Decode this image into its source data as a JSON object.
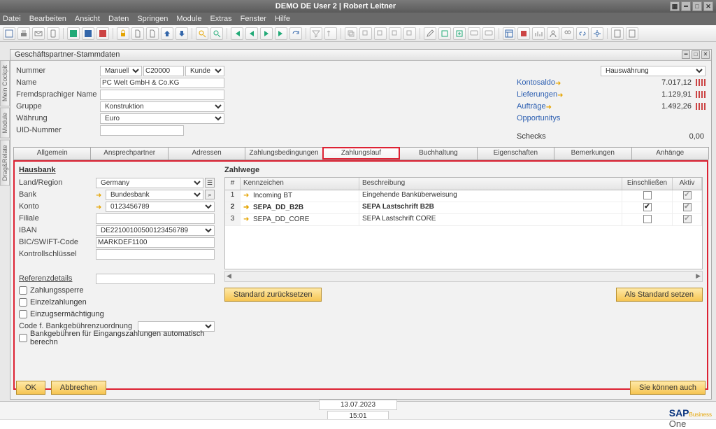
{
  "title_center": "DEMO DE User 2 | Robert Leitner",
  "menu": [
    "Datei",
    "Bearbeiten",
    "Ansicht",
    "Daten",
    "Springen",
    "Module",
    "Extras",
    "Fenster",
    "Hilfe"
  ],
  "window_title": "Geschäftspartner-Stammdaten",
  "sidetabs": [
    "Mein Cockpit",
    "Module",
    "Drag&Relate"
  ],
  "header": {
    "nummer_lbl": "Nummer",
    "nummer_mode": "Manuell",
    "nummer_val": "C20000",
    "nummer_type": "Kunde",
    "name_lbl": "Name",
    "name_val": "PC Welt GmbH & Co.KG",
    "fremd_lbl": "Fremdsprachiger Name",
    "fremd_val": "",
    "gruppe_lbl": "Gruppe",
    "gruppe_val": "Konstruktion",
    "waehrung_lbl": "Währung",
    "waehrung_val": "Euro",
    "uid_lbl": "UID-Nummer",
    "uid_val": ""
  },
  "right": {
    "hauswaehrung": "Hauswährung",
    "kontosaldo_lbl": "Kontosaldo",
    "kontosaldo_val": "7.017,12",
    "lieferungen_lbl": "Lieferungen",
    "lieferungen_val": "1.129,91",
    "auftraege_lbl": "Aufträge",
    "auftraege_val": "1.492,26",
    "opp_lbl": "Opportunitys",
    "opp_val": "",
    "schecks_lbl": "Schecks",
    "schecks_val": "0,00"
  },
  "tabs": [
    "Allgemein",
    "Ansprechpartner",
    "Adressen",
    "Zahlungsbedingungen",
    "Zahlungslauf",
    "Buchhaltung",
    "Eigenschaften",
    "Bemerkungen",
    "Anhänge"
  ],
  "active_tab": 4,
  "hausbank": {
    "title": "Hausbank",
    "land_lbl": "Land/Region",
    "land_val": "Germany",
    "bank_lbl": "Bank",
    "bank_val": "Bundesbank",
    "konto_lbl": "Konto",
    "konto_val": "0123456789",
    "filiale_lbl": "Filiale",
    "filiale_val": "",
    "iban_lbl": "IBAN",
    "iban_val": "DE22100100500123456789",
    "bic_lbl": "BIC/SWIFT-Code",
    "bic_val": "MARKDEF1100",
    "ks_lbl": "Kontrollschlüssel",
    "ks_val": ""
  },
  "ref": {
    "title": "Referenzdetails",
    "ref_val": "",
    "zahlungssperre": "Zahlungssperre",
    "einzelzahlungen": "Einzelzahlungen",
    "einzug": "Einzugsermächtigung",
    "code_lbl": "Code f. Bankgebührenzuordnung",
    "autobank": "Bankgebühren für Eingangszahlungen automatisch berechn"
  },
  "zahlwege": {
    "title": "Zahlwege",
    "cols": {
      "idx": "#",
      "k": "Kennzeichen",
      "d": "Beschreibung",
      "e": "Einschließen",
      "a": "Aktiv"
    },
    "rows": [
      {
        "n": "1",
        "k": "Incoming BT",
        "d": "Eingehende Banküberweisung",
        "inc": false,
        "akt": true,
        "bold": false
      },
      {
        "n": "2",
        "k": "SEPA_DD_B2B",
        "d": "SEPA Lastschrift B2B",
        "inc": true,
        "akt": true,
        "bold": true
      },
      {
        "n": "3",
        "k": "SEPA_DD_CORE",
        "d": "SEPA Lastschrift CORE",
        "inc": false,
        "akt": true,
        "bold": false
      }
    ]
  },
  "buttons": {
    "reset": "Standard zurücksetzen",
    "setdefault": "Als Standard setzen",
    "ok": "OK",
    "cancel": "Abbrechen",
    "youcan": "Sie können auch"
  },
  "status": {
    "date": "13.07.2023",
    "time": "15:01"
  },
  "brand": {
    "sap": "SAP",
    "one": "One",
    "biz": "Business"
  }
}
